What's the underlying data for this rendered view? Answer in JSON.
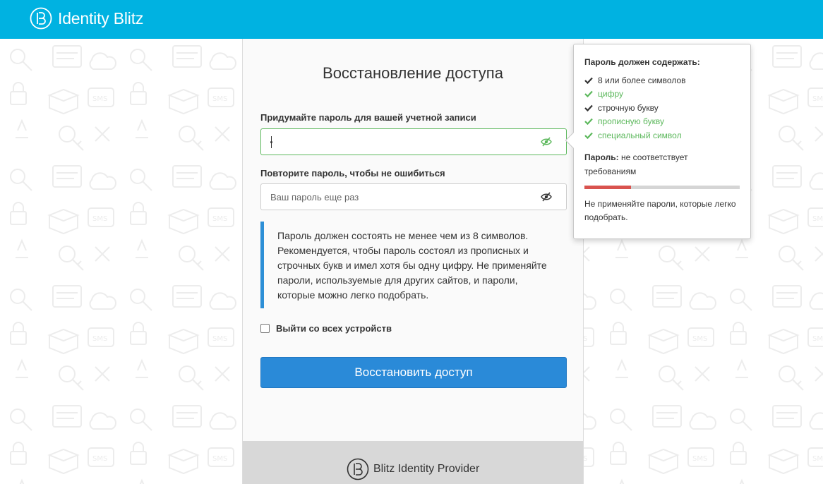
{
  "header": {
    "brand_name": "Identity Blitz",
    "color": "#00b2e1"
  },
  "card": {
    "title": "Восстановление доступа",
    "password_label": "Придумайте пароль для вашей учетной записи",
    "password_value": "",
    "repeat_label": "Повторите пароль, чтобы не ошибиться",
    "repeat_placeholder": "Ваш пароль еще раз",
    "info_text": "Пароль должен состоять не менее чем из 8 символов. Рекомендуется, чтобы пароль состоял из прописных и строчных букв и имел хотя бы одну цифру. Не применяйте пароли, используемые для других сайтов, и пароли, которые можно легко подобрать.",
    "logout_label": "Выйти со всех устройств",
    "logout_checked": false,
    "submit_label": "Восстановить доступ",
    "footer_brand": "Blitz Identity Provider"
  },
  "popover": {
    "title": "Пароль должен содержать:",
    "requirements": [
      {
        "label": "8 или более символов",
        "met": false
      },
      {
        "label": "цифру",
        "met": true
      },
      {
        "label": "строчную букву",
        "met": false
      },
      {
        "label": "прописную букву",
        "met": true
      },
      {
        "label": "специальный символ",
        "met": true
      }
    ],
    "strength_label": "Пароль:",
    "strength_value": "не соответствует требованиям",
    "strength_level": 0.3,
    "strength_color": "#d9534f",
    "note": "Не применяйте пароли, которые легко подобрать."
  },
  "colors": {
    "accent": "#2a8ad8",
    "success": "#5cb85c",
    "info_border": "#2d8fd6"
  }
}
